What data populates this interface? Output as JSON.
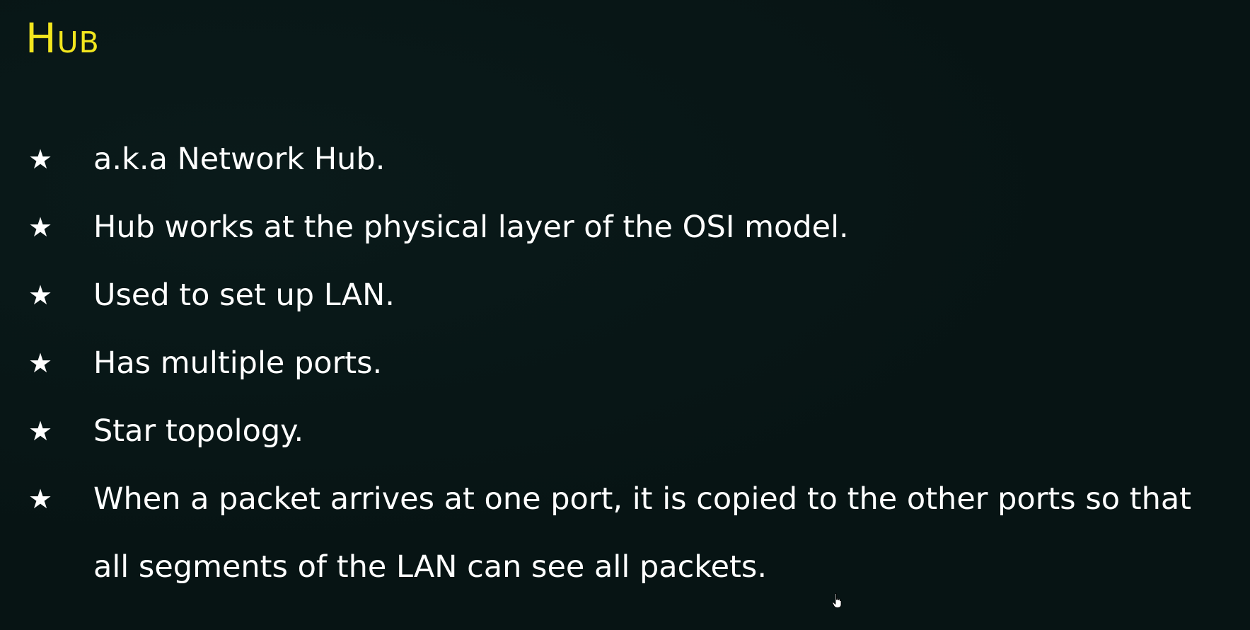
{
  "slide": {
    "title": "Hub",
    "bullet_icon": "star-icon",
    "bullets": [
      {
        "text": "a.k.a Network Hub."
      },
      {
        "text": "Hub works at the physical layer of the OSI model."
      },
      {
        "text": "Used to set up LAN."
      },
      {
        "text": "Has multiple ports."
      },
      {
        "text": "Star topology."
      },
      {
        "text": "When a packet arrives at one port, it is copied to the other ports so that all segments of the LAN can see all packets."
      }
    ]
  },
  "colors": {
    "background": "#071414",
    "title": "#f2e61e",
    "text": "#ffffff"
  },
  "cursor_icon": "hand-pointer-icon"
}
